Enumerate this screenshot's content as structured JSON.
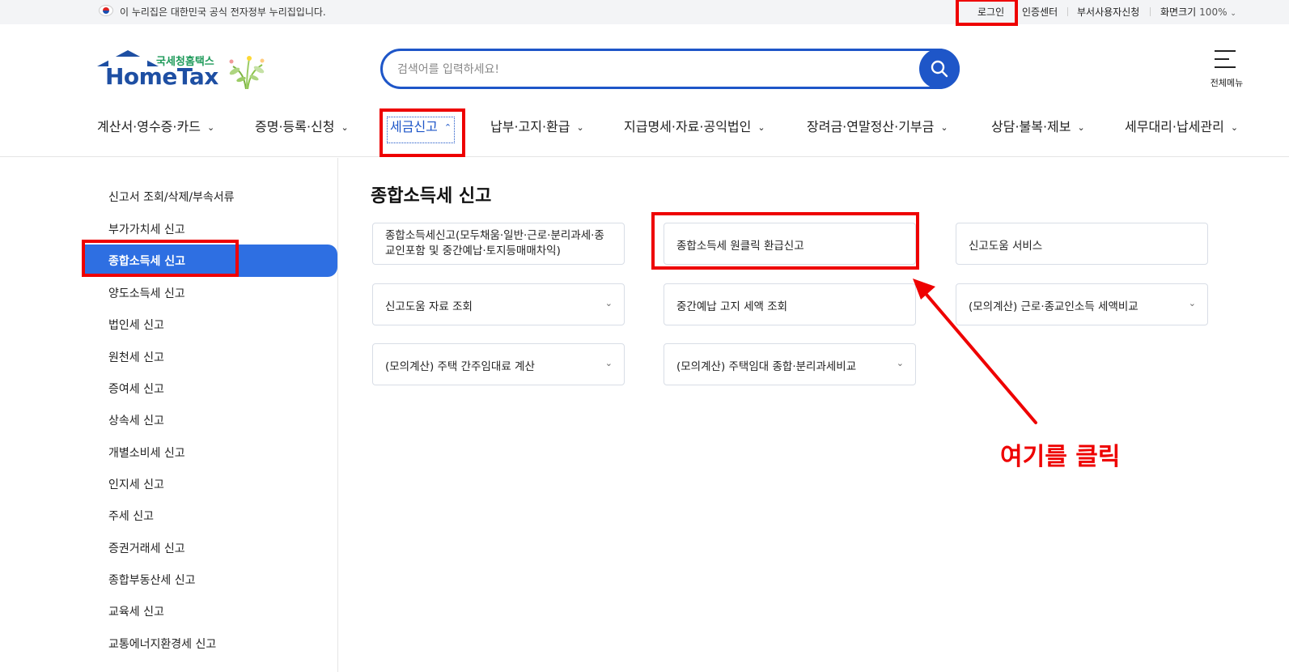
{
  "utility": {
    "gov_notice": "이 누리집은 대한민국 공식 전자정부 누리집입니다.",
    "login": "로그인",
    "cert_center": "인증센터",
    "dept_user": "부서사용자신청",
    "zoom_label": "화면크기",
    "zoom_value": "100%"
  },
  "logo": {
    "sub": "국세청홈택스",
    "main": "HomeTax"
  },
  "search": {
    "placeholder": "검색어를 입력하세요!"
  },
  "allmenu": {
    "label": "전체메뉴"
  },
  "gnb": [
    {
      "label": "계산서·영수증·카드"
    },
    {
      "label": "증명·등록·신청"
    },
    {
      "label": "세금신고"
    },
    {
      "label": "납부·고지·환급"
    },
    {
      "label": "지급명세·자료·공익법인"
    },
    {
      "label": "장려금·연말정산·기부금"
    },
    {
      "label": "상담·불복·제보"
    },
    {
      "label": "세무대리·납세관리"
    }
  ],
  "sidenav": [
    {
      "label": "신고서 조회/삭제/부속서류"
    },
    {
      "label": "부가가치세 신고"
    },
    {
      "label": "종합소득세 신고"
    },
    {
      "label": "양도소득세 신고"
    },
    {
      "label": "법인세 신고"
    },
    {
      "label": "원천세 신고"
    },
    {
      "label": "증여세 신고"
    },
    {
      "label": "상속세 신고"
    },
    {
      "label": "개별소비세 신고"
    },
    {
      "label": "인지세 신고"
    },
    {
      "label": "주세 신고"
    },
    {
      "label": "증권거래세 신고"
    },
    {
      "label": "종합부동산세 신고"
    },
    {
      "label": "교육세 신고"
    },
    {
      "label": "교통에너지환경세 신고"
    }
  ],
  "content": {
    "title": "종합소득세 신고",
    "cards": [
      {
        "label": "종합소득세신고(모두채움·일반·근로·분리과세·종교인포함 및 중간예납·토지등매매차익)"
      },
      {
        "label": "종합소득세 원클릭 환급신고"
      },
      {
        "label": "신고도움 서비스"
      },
      {
        "label": "신고도움 자료 조회"
      },
      {
        "label": "중간예납 고지 세액 조회"
      },
      {
        "label": "(모의계산) 근로·종교인소득 세액비교"
      },
      {
        "label": "(모의계산) 주택 간주임대료 계산"
      },
      {
        "label": "(모의계산) 주택임대 종합·분리과세비교"
      }
    ]
  },
  "annotation": {
    "note": "여기를 클릭",
    "color": "#ee0000"
  }
}
